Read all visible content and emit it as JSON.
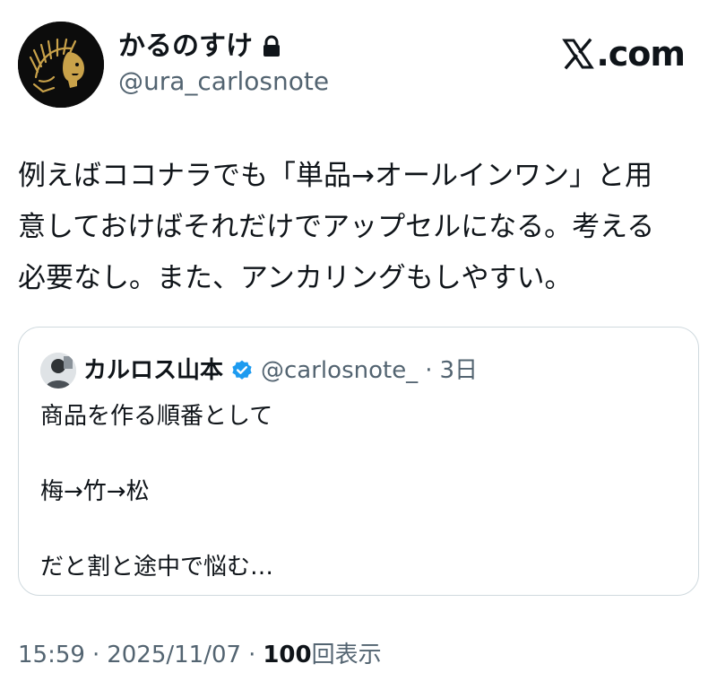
{
  "author": {
    "name": "かるのすけ",
    "handle": "@ura_carlosnote",
    "protected_icon": "lock-icon"
  },
  "brand": {
    "logo_text": ".com",
    "logo_icon": "x-logo-icon"
  },
  "tweet": {
    "text": "例えばココナラでも「単品→オールインワン」と用\n意しておけばそれだけでアップセルになる。考える\n必要なし。また、アンカリングもしやすい。"
  },
  "quote": {
    "name": "カルロス山本",
    "verified_icon": "verified-badge-icon",
    "handle": "@carlosnote_",
    "separator": "·",
    "date": "3日",
    "body": "商品を作る順番として\n\n梅→竹→松\n\nだと割と途中で悩む…"
  },
  "meta": {
    "time": "15:59",
    "sep1": "·",
    "date": "2025/11/07",
    "sep2": "·",
    "views_count": "100",
    "views_label": "回表示"
  },
  "colors": {
    "text": "#0f1419",
    "secondary": "#536471",
    "border": "#cfd9de",
    "verified": "#1d9bf0",
    "avatar_gold": "#c9a24a"
  }
}
